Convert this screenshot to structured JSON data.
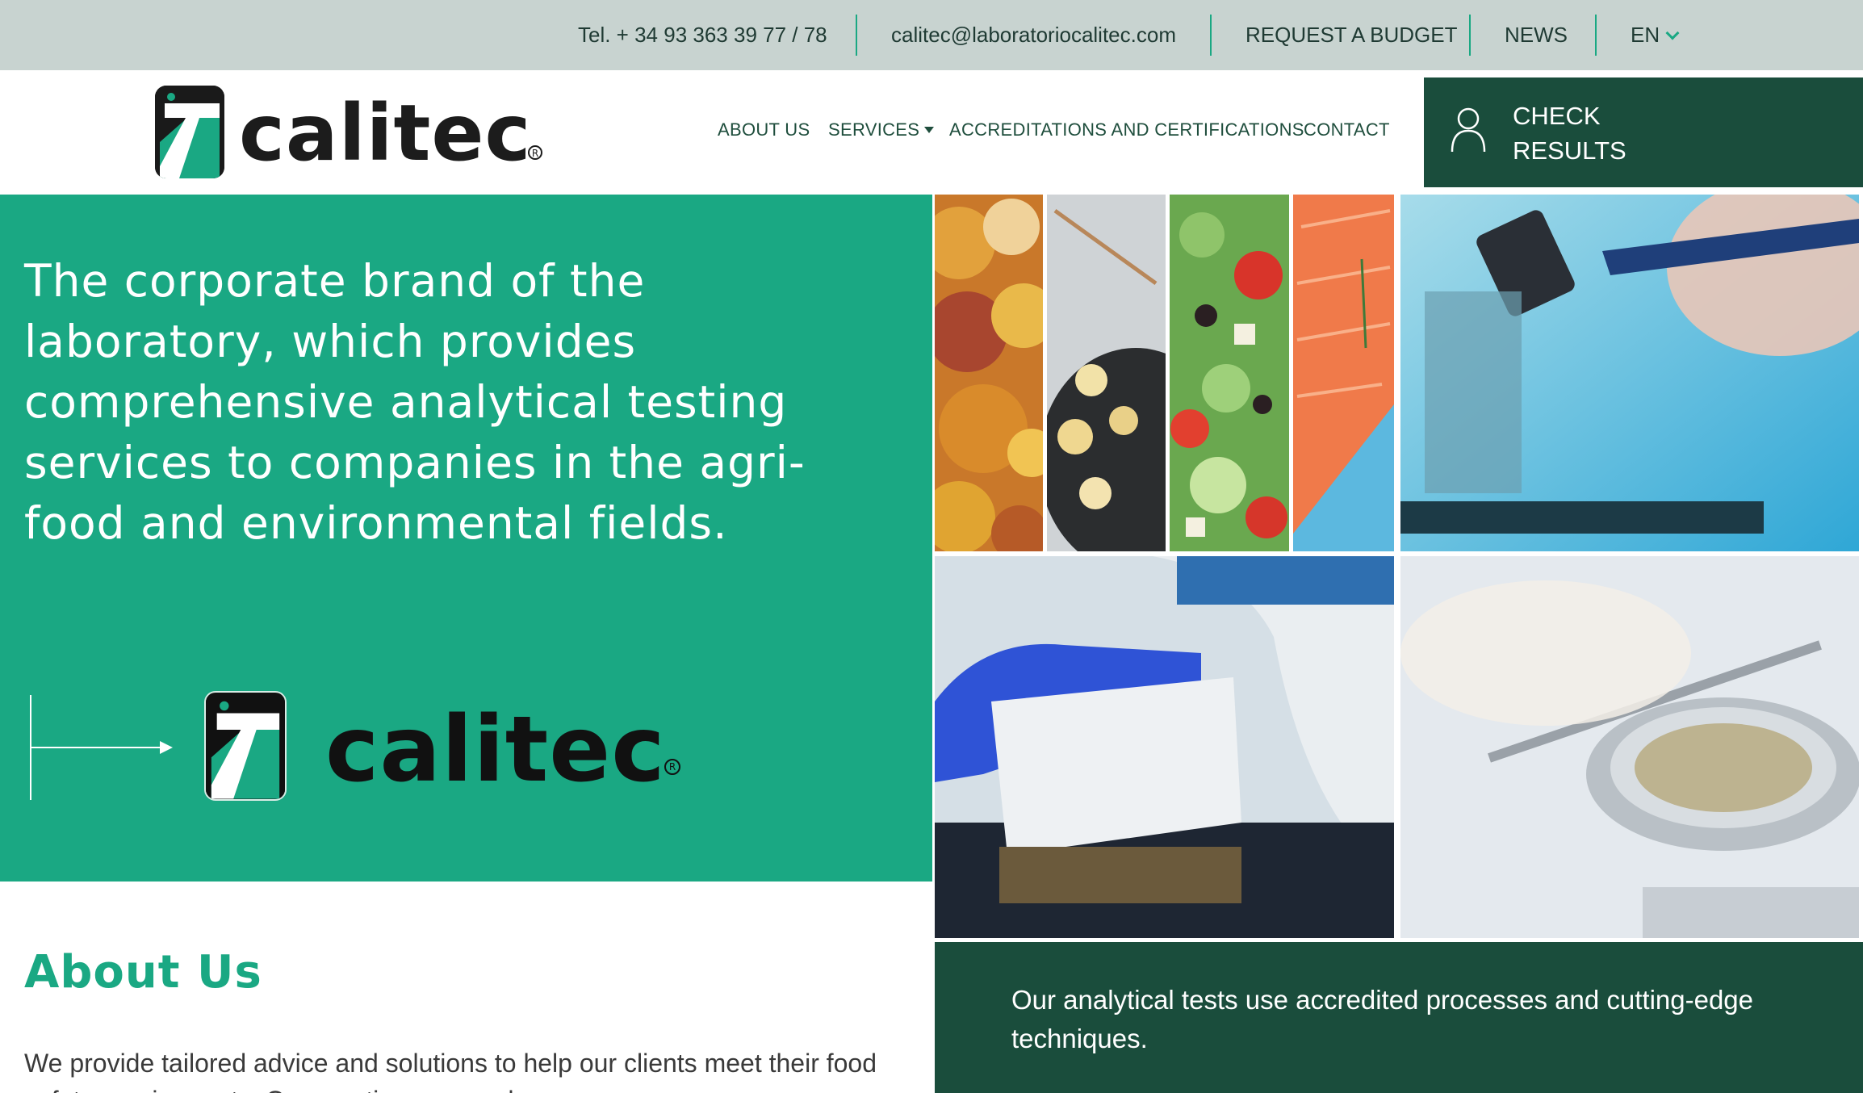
{
  "topbar": {
    "phone": "Tel. + 34 93 363 39 77 / 78",
    "email": "calitec@laboratoriocalitec.com",
    "budget": "REQUEST A BUDGET",
    "news": "NEWS",
    "language": "EN"
  },
  "brand": {
    "name": "calitec",
    "registered": "R"
  },
  "nav": {
    "items": [
      "ABOUT US",
      "SERVICES",
      "ACCREDITATIONS AND CERTIFICATIONS",
      "CONTACT"
    ],
    "services_has_dropdown": true
  },
  "check_results": {
    "line1": "CHECK",
    "line2": "RESULTS",
    "icon": "user-icon"
  },
  "hero": {
    "text": "The corporate brand of the laboratory, which provides comprehensive analytical testing services to companies in the agri-food and environmental fields."
  },
  "gallery": {
    "tiles": [
      "chips-photo",
      "pasta-photo",
      "salad-photo",
      "salmon-photo",
      "microscope-photo",
      "pcr-plate-photo",
      "powder-sample-photo"
    ]
  },
  "about": {
    "title": "About Us",
    "body": "We provide tailored advice and solutions to help our clients meet their food safety requirements. Our practices are unde"
  },
  "note": {
    "text": "Our analytical tests use accredited processes and cutting-edge techniques."
  },
  "colors": {
    "green": "#1aa883",
    "dark_green": "#1a4d3c",
    "topbar": "#c8d3d0"
  }
}
